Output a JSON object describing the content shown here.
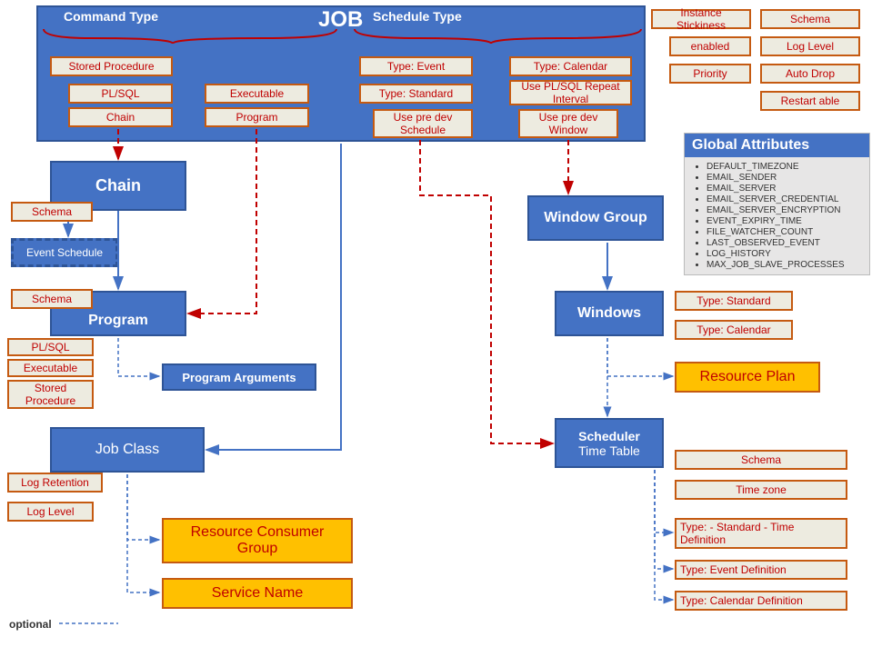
{
  "header": {
    "commandType": "Command Type",
    "job": "JOB",
    "scheduleType": "Schedule Type"
  },
  "topRight": {
    "instanceStickiness": "Instance Stickiness",
    "schema": "Schema",
    "enabled": "enabled",
    "logLevel": "Log Level",
    "priority": "Priority",
    "autoDrop": "Auto Drop",
    "restartable": "Restart able"
  },
  "commandCol1": {
    "storedProcedure": "Stored Procedure",
    "plsql": "PL/SQL",
    "chain": "Chain"
  },
  "commandCol2": {
    "executable": "Executable",
    "program": "Program"
  },
  "scheduleCol1": {
    "typeEvent": "Type: Event",
    "typeStandard": "Type: Standard",
    "usePreDevSchedule": "Use pre dev Schedule"
  },
  "scheduleCol2": {
    "typeCalendar": "Type: Calendar",
    "usePlsqlRepeat": "Use PL/SQL Repeat Interval",
    "usePreDevWindow": "Use pre dev Window"
  },
  "chainBox": {
    "title": "Chain",
    "schema": "Schema",
    "eventSchedule": "Event Schedule"
  },
  "programBox": {
    "title": "Program",
    "schema": "Schema",
    "plsql": "PL/SQL",
    "executable": "Executable",
    "storedProcedure": "Stored Procedure",
    "programArguments": "Program Arguments"
  },
  "jobClass": {
    "title": "Job Class",
    "logRetention": "Log Retention",
    "logLevel": "Log Level",
    "resourceConsumerGroup": "Resource Consumer Group",
    "serviceName": "Service Name"
  },
  "windowGroup": {
    "title": "Window Group"
  },
  "windows": {
    "title": "Windows",
    "typeStandard": "Type: Standard",
    "typeCalendar": "Type: Calendar",
    "resourcePlan": "Resource Plan"
  },
  "scheduler": {
    "title1": "Scheduler",
    "title2": "Time Table",
    "schema": "Schema",
    "timeZone": "Time zone",
    "typeStdTime": "Type: - Standard - Time Definition",
    "typeEvent": "Type: Event Definition",
    "typeCalendar": "Type: Calendar Definition"
  },
  "globalAttr": {
    "title": "Global Attributes",
    "items": [
      "DEFAULT_TIMEZONE",
      "EMAIL_SENDER",
      "EMAIL_SERVER",
      "EMAIL_SERVER_CREDENTIAL",
      "EMAIL_SERVER_ENCRYPTION",
      "EVENT_EXPIRY_TIME",
      "FILE_WATCHER_COUNT",
      "LAST_OBSERVED_EVENT",
      "LOG_HISTORY",
      "MAX_JOB_SLAVE_PROCESSES"
    ]
  },
  "legend": {
    "optional": "optional"
  }
}
